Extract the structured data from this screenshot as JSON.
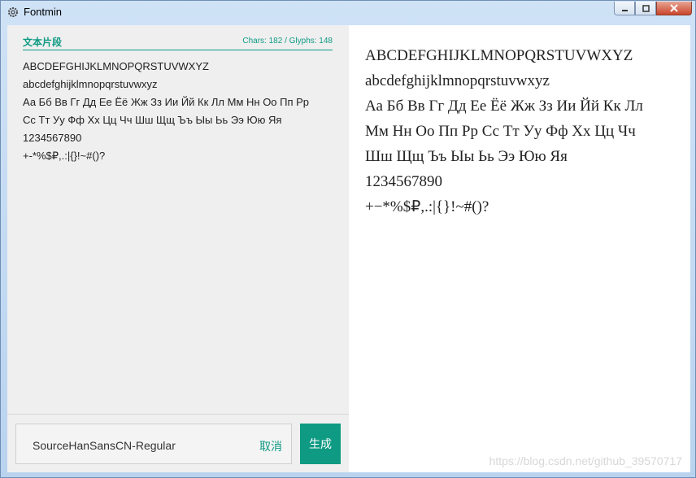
{
  "window": {
    "title": "Fontmin",
    "icon": "gear-icon"
  },
  "left_panel": {
    "section_title": "文本片段",
    "stats": "Chars: 182 / Glyphs: 148",
    "text_lines": [
      "ABCDEFGHIJKLMNOPQRSTUVWXYZ",
      "abcdefghijklmnopqrstuvwxyz",
      "Аа Бб Вв Гг Дд Ее Ёё Жж Зз Ии Йй Кк Лл Мм Нн Оо Пп Рр",
      "Сс Тт Уу Фф Хх Цц Чч Шш Щщ Ъъ Ыы Ьь Ээ Юю Яя",
      "1234567890",
      "+-*%$₽,.:|{}!~#()?"
    ]
  },
  "font_selector": {
    "value": "SourceHanSansCN-Regular",
    "cancel_label": "取消"
  },
  "generate_button": {
    "label": "生成"
  },
  "preview": {
    "lines": [
      "ABCDEFGHIJKLMNOPQRSTUVWXYZ",
      "abcdefghijklmnopqrstuvwxyz",
      "Аа Бб Вв Гг Дд Ее Ёё Жж Зз Ии Йй Кк Лл",
      "Мм Нн Оо Пп Рр Сс Тт Уу Фф Хх Цц Чч",
      "Шш Щщ Ъъ Ыы Ьь Ээ Юю Яя",
      "1234567890",
      "+−*%$₽,.:|{}!~#()?"
    ]
  },
  "watermark": "https://blog.csdn.net/github_39570717",
  "colors": {
    "accent": "#0e9a83",
    "left_bg": "#efefef"
  }
}
